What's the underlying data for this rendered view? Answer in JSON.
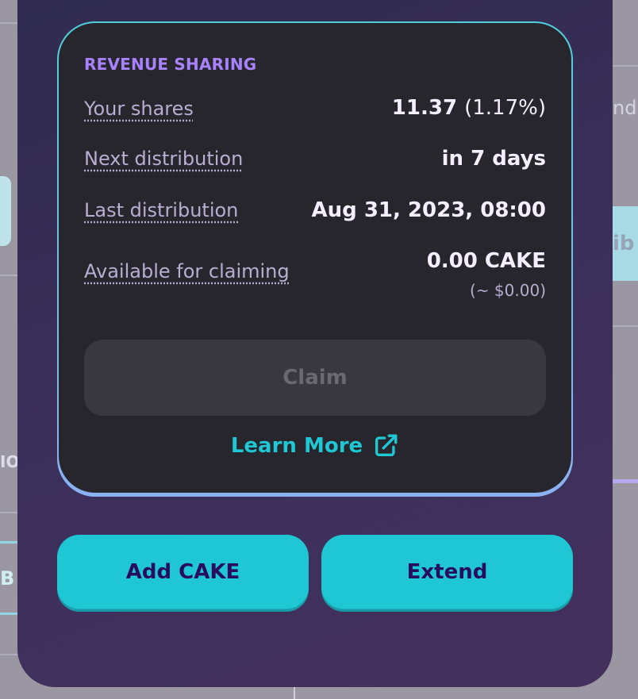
{
  "background": {
    "fragments": {
      "right_top": "ndr",
      "right_mid": "ib",
      "left_mid": "IO",
      "left_low": "B"
    }
  },
  "revenue": {
    "title": "REVENUE SHARING",
    "rows": [
      {
        "label": "Your shares",
        "value": "11.37",
        "value_extra": "(1.17%)"
      },
      {
        "label": "Next distribution",
        "value": "in 7 days"
      },
      {
        "label": "Last distribution",
        "value": "Aug 31, 2023, 08:00"
      },
      {
        "label": "Available for claiming",
        "value": "0.00 CAKE",
        "sub": "(~ $0.00)"
      }
    ],
    "claim_label": "Claim",
    "learn_more_label": "Learn More",
    "learn_more_icon": "external-link-icon"
  },
  "actions": {
    "add_label": "Add CAKE",
    "extend_label": "Extend"
  },
  "colors": {
    "accent": "#1fc7d4",
    "title_purple": "#a881fc",
    "card_bg": "#27262c",
    "button_text": "#280d5f"
  }
}
